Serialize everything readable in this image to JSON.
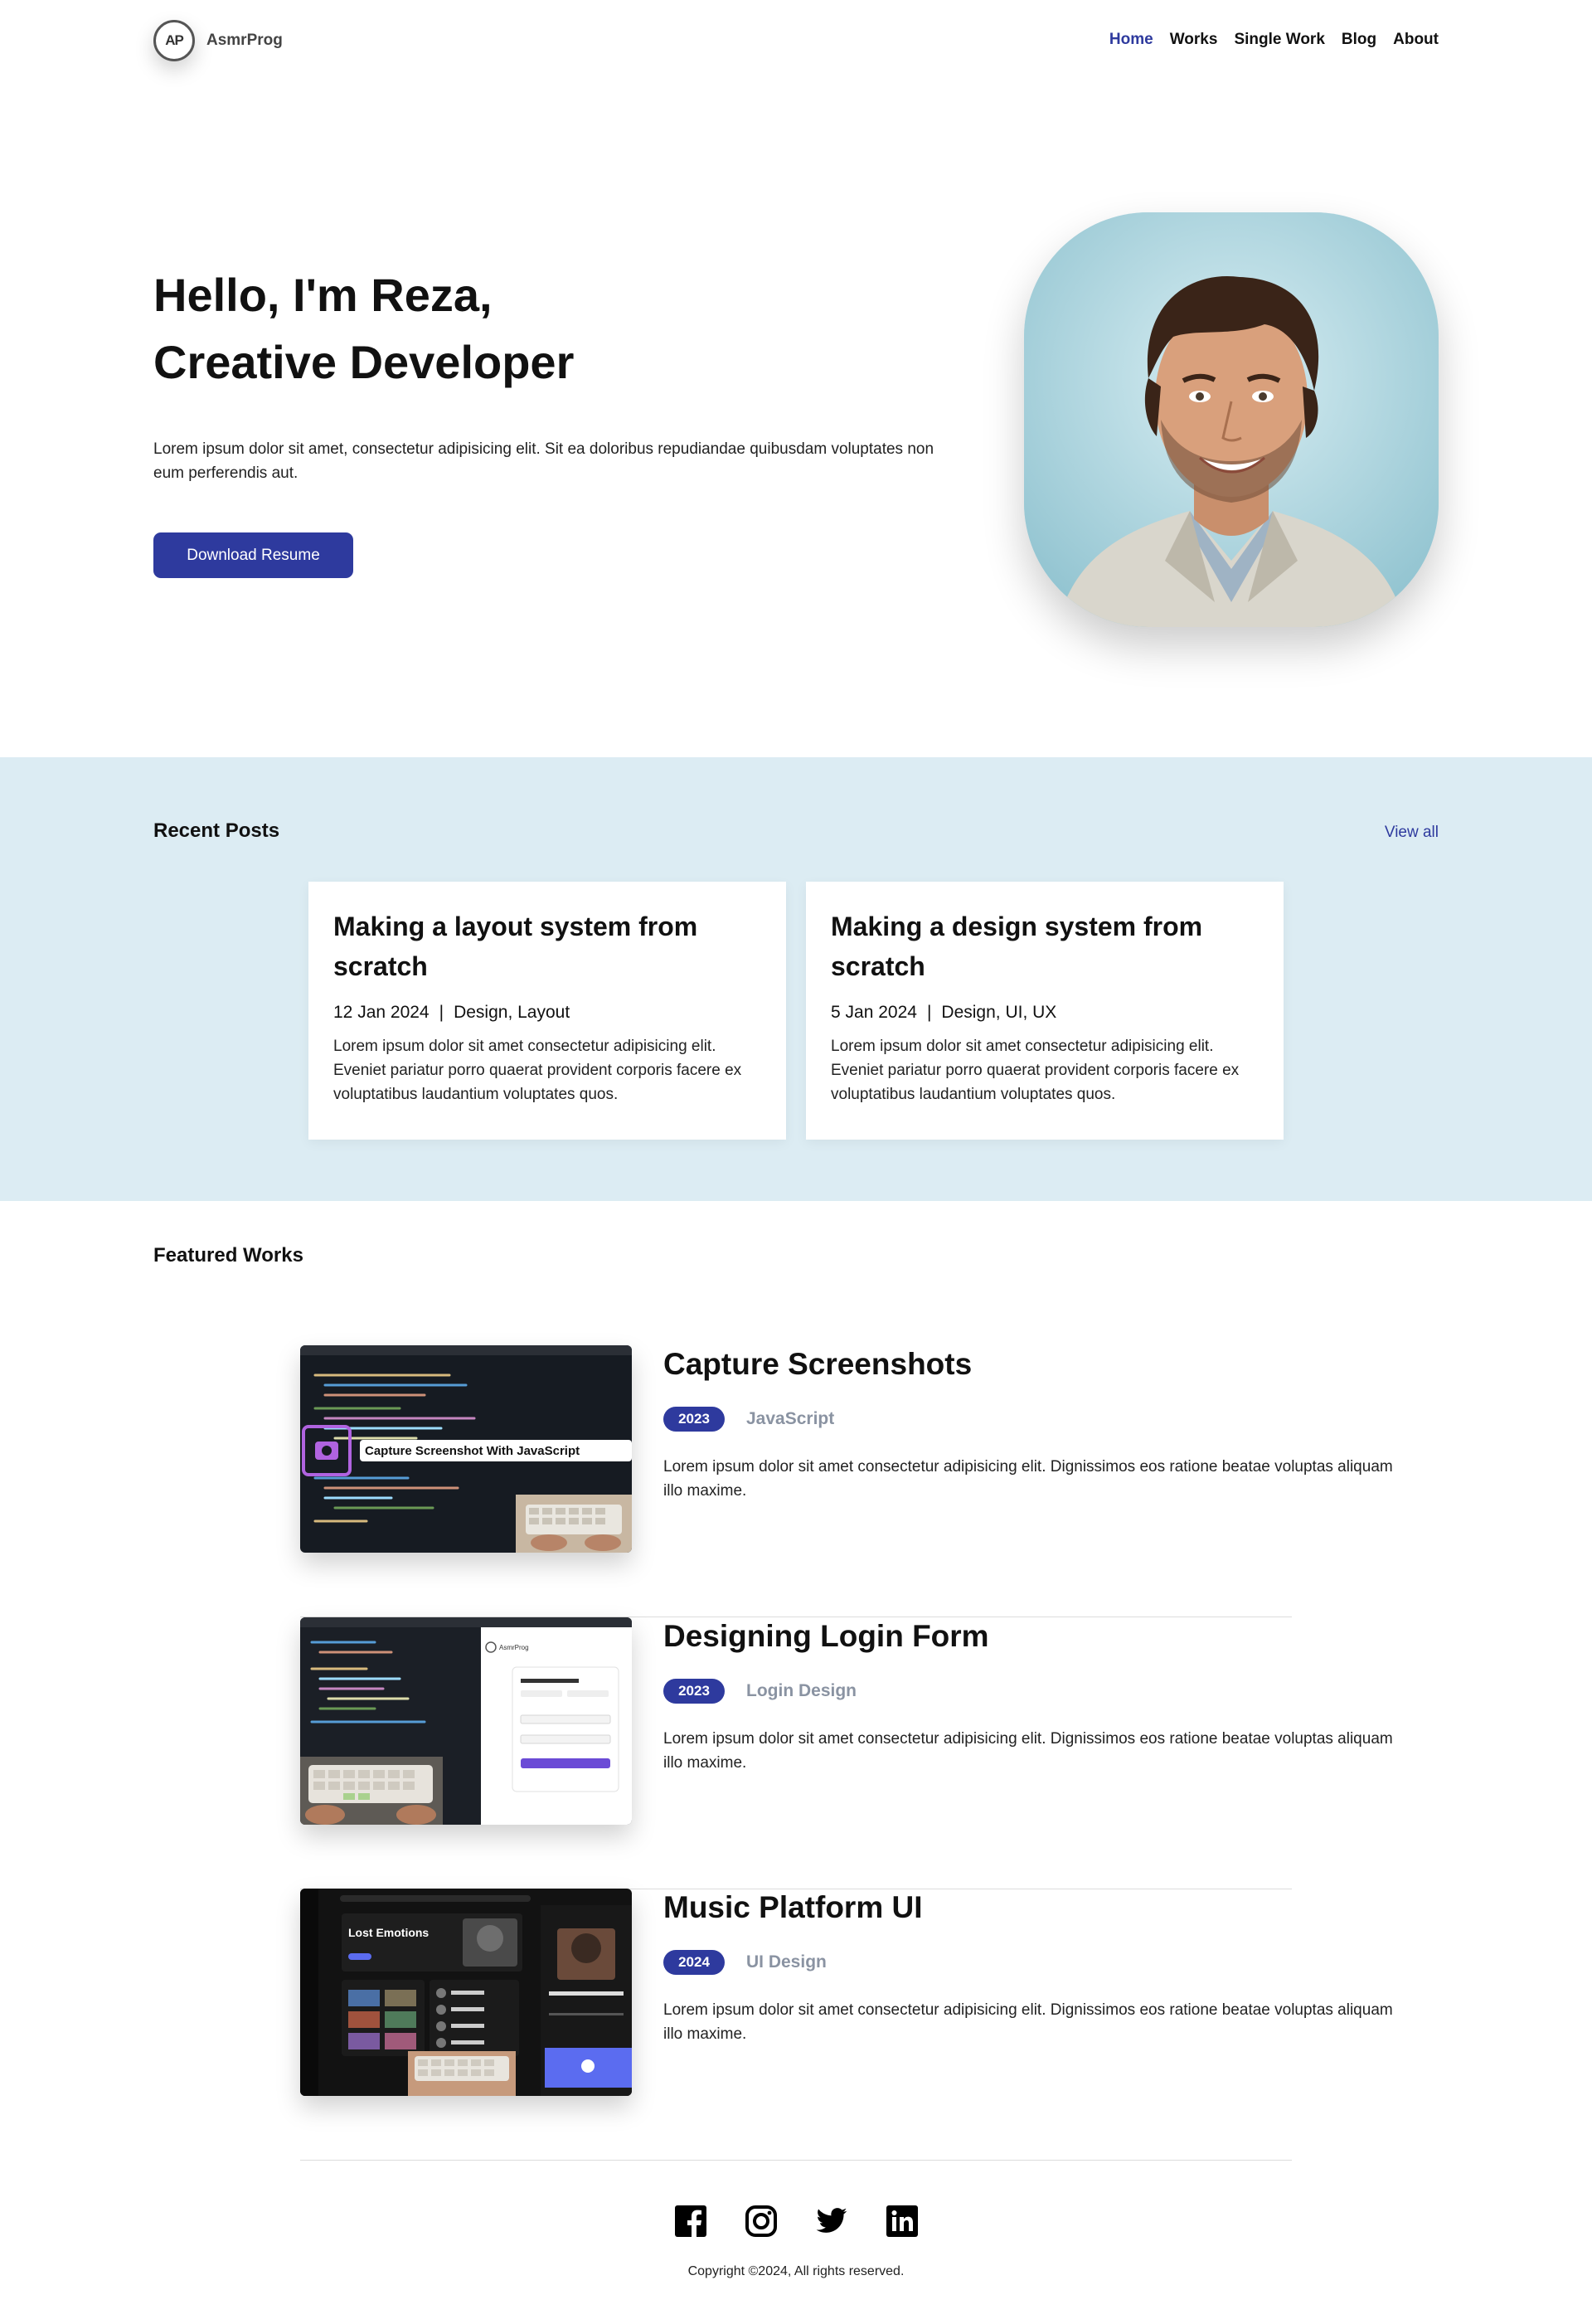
{
  "brand": {
    "logo_mark": "AP",
    "name": "AsmrProg"
  },
  "nav": {
    "items": [
      "Home",
      "Works",
      "Single Work",
      "Blog",
      "About"
    ],
    "active": "Home"
  },
  "hero": {
    "line1": "Hello, I'm Reza,",
    "line2": "Creative Developer",
    "description": "Lorem ipsum dolor sit amet, consectetur adipisicing elit. Sit ea doloribus repudiandae quibusdam voluptates non eum perferendis aut.",
    "button": "Download Resume"
  },
  "posts": {
    "title": "Recent Posts",
    "view_all": "View all",
    "items": [
      {
        "title": "Making a layout system from scratch",
        "date": "12 Jan 2024",
        "sep": "|",
        "tags": "Design, Layout",
        "text": "Lorem ipsum dolor sit amet consectetur adipisicing elit. Eveniet pariatur porro quaerat provident corporis facere ex voluptatibus laudantium voluptates quos."
      },
      {
        "title": "Making a design system from scratch",
        "date": "5 Jan 2024",
        "sep": "|",
        "tags": "Design, UI, UX",
        "text": "Lorem ipsum dolor sit amet consectetur adipisicing elit. Eveniet pariatur porro quaerat provident corporis facere ex voluptatibus laudantium voluptates quos."
      }
    ]
  },
  "works": {
    "title": "Featured Works",
    "items": [
      {
        "title": "Capture Screenshots",
        "year": "2023",
        "category": "JavaScript",
        "desc": "Lorem ipsum dolor sit amet consectetur adipisicing elit. Dignissimos eos ratione beatae voluptas aliquam illo maxime.",
        "thumb_caption": "Capture Screenshot With JavaScript"
      },
      {
        "title": "Designing Login Form",
        "year": "2023",
        "category": "Login Design",
        "desc": "Lorem ipsum dolor sit amet consectetur adipisicing elit. Dignissimos eos ratione beatae voluptas aliquam illo maxime.",
        "thumb_caption": "AsmrProg"
      },
      {
        "title": "Music Platform UI",
        "year": "2024",
        "category": "UI Design",
        "desc": "Lorem ipsum dolor sit amet consectetur adipisicing elit. Dignissimos eos ratione beatae voluptas aliquam illo maxime.",
        "thumb_caption": "Lost Emotions"
      }
    ]
  },
  "footer": {
    "icons": [
      "facebook-icon",
      "instagram-icon",
      "twitter-icon",
      "linkedin-icon"
    ],
    "copyright": "Copyright ©2024, All rights reserved."
  },
  "colors": {
    "accent": "#2e3a9e",
    "band": "#dcecf3",
    "muted": "#8a93a2"
  }
}
